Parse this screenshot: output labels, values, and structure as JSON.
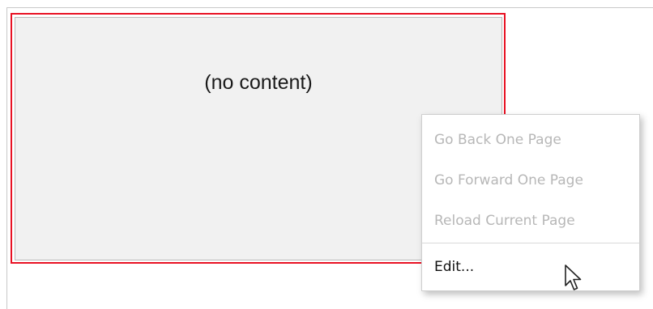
{
  "panel": {
    "placeholder_text": "(no content)"
  },
  "context_menu": {
    "items": [
      {
        "label": "Go Back One Page",
        "enabled": false
      },
      {
        "label": "Go Forward One Page",
        "enabled": false
      },
      {
        "label": "Reload Current Page",
        "enabled": false
      },
      {
        "label": "Edit...",
        "enabled": true
      }
    ]
  },
  "colors": {
    "outline": "#e81123",
    "panel_background": "#f1f1f1",
    "disabled_text": "#b7b7b7",
    "enabled_text": "#111111"
  },
  "icons": {
    "cursor": "arrow-pointer-icon"
  }
}
